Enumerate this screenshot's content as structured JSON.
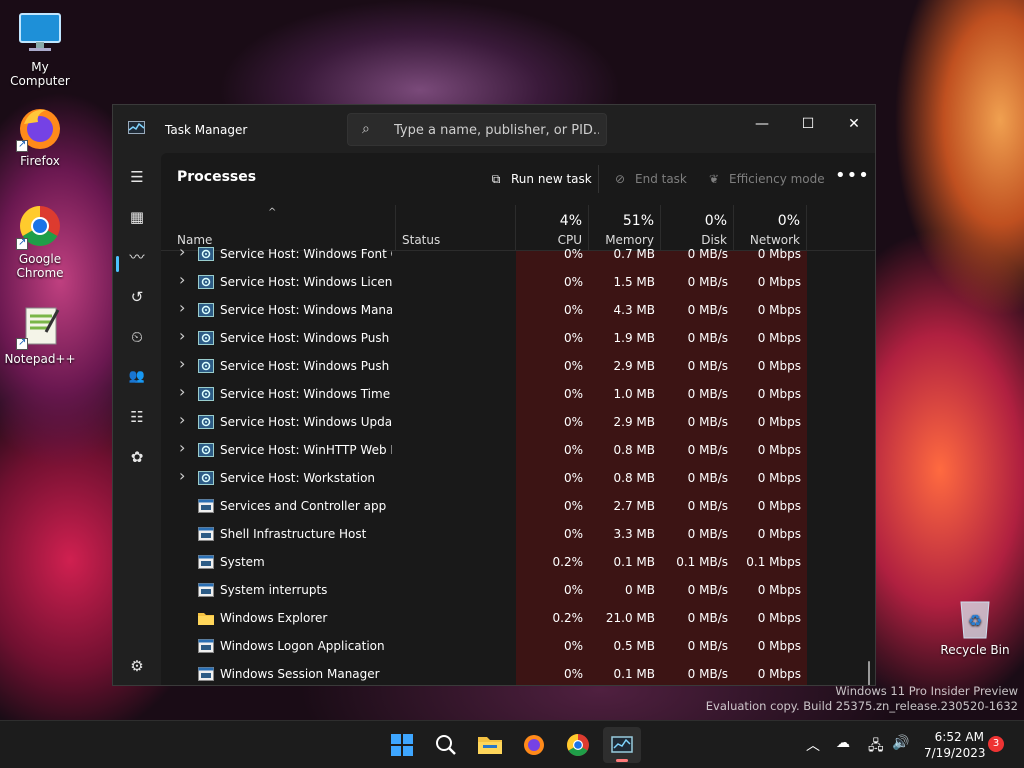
{
  "desktop": {
    "icons": [
      {
        "label": "My Computer"
      },
      {
        "label": "Firefox"
      },
      {
        "label": "Google Chrome"
      },
      {
        "label": "Notepad++"
      }
    ],
    "recycle_bin": "Recycle Bin",
    "watermark": {
      "line1": "Windows 11 Pro Insider Preview",
      "line2": "Evaluation copy. Build 25375.zn_release.230520-1632"
    }
  },
  "window": {
    "title": "Task Manager",
    "search_placeholder": "Type a name, publisher, or PID...",
    "controls": {
      "minimize": "—",
      "maximize": "☐",
      "close": "✕"
    }
  },
  "rail": {
    "items": [
      {
        "icon": "hamburger-icon",
        "glyph": "☰"
      },
      {
        "icon": "processes-icon",
        "glyph": "▦"
      },
      {
        "icon": "performance-icon",
        "glyph": "〰"
      },
      {
        "icon": "app-history-icon",
        "glyph": "↺"
      },
      {
        "icon": "startup-apps-icon",
        "glyph": "⏲"
      },
      {
        "icon": "users-icon",
        "glyph": "👥"
      },
      {
        "icon": "details-icon",
        "glyph": "☷"
      },
      {
        "icon": "services-icon",
        "glyph": "✿"
      },
      {
        "icon": "settings-icon",
        "glyph": "⚙"
      }
    ]
  },
  "page": {
    "heading": "Processes",
    "run_new_task": "Run new task",
    "end_task": "End task",
    "efficiency_mode": "Efficiency mode",
    "more": "•••"
  },
  "columns": {
    "name": "Name",
    "status": "Status",
    "cpu": {
      "label": "CPU",
      "pct": "4%"
    },
    "memory": {
      "label": "Memory",
      "pct": "51%"
    },
    "disk": {
      "label": "Disk",
      "pct": "0%"
    },
    "network": {
      "label": "Network",
      "pct": "0%"
    }
  },
  "processes": [
    {
      "name": "Service Host: Windows Font C...",
      "expandable": true,
      "icon": "gear",
      "cpu": "0%",
      "mem": "0.7 MB",
      "disk": "0 MB/s",
      "net": "0 Mbps"
    },
    {
      "name": "Service Host: Windows Licens...",
      "expandable": true,
      "icon": "gear",
      "cpu": "0%",
      "mem": "1.5 MB",
      "disk": "0 MB/s",
      "net": "0 Mbps"
    },
    {
      "name": "Service Host: Windows Manag...",
      "expandable": true,
      "icon": "gear",
      "cpu": "0%",
      "mem": "4.3 MB",
      "disk": "0 MB/s",
      "net": "0 Mbps"
    },
    {
      "name": "Service Host: Windows Push ...",
      "expandable": true,
      "icon": "gear",
      "cpu": "0%",
      "mem": "1.9 MB",
      "disk": "0 MB/s",
      "net": "0 Mbps"
    },
    {
      "name": "Service Host: Windows Push ...",
      "expandable": true,
      "icon": "gear",
      "cpu": "0%",
      "mem": "2.9 MB",
      "disk": "0 MB/s",
      "net": "0 Mbps"
    },
    {
      "name": "Service Host: Windows Time",
      "expandable": true,
      "icon": "gear",
      "cpu": "0%",
      "mem": "1.0 MB",
      "disk": "0 MB/s",
      "net": "0 Mbps"
    },
    {
      "name": "Service Host: Windows Update",
      "expandable": true,
      "icon": "gear",
      "cpu": "0%",
      "mem": "2.9 MB",
      "disk": "0 MB/s",
      "net": "0 Mbps"
    },
    {
      "name": "Service Host: WinHTTP Web P...",
      "expandable": true,
      "icon": "gear",
      "cpu": "0%",
      "mem": "0.8 MB",
      "disk": "0 MB/s",
      "net": "0 Mbps"
    },
    {
      "name": "Service Host: Workstation",
      "expandable": true,
      "icon": "gear",
      "cpu": "0%",
      "mem": "0.8 MB",
      "disk": "0 MB/s",
      "net": "0 Mbps"
    },
    {
      "name": "Services and Controller app",
      "expandable": false,
      "icon": "window",
      "cpu": "0%",
      "mem": "2.7 MB",
      "disk": "0 MB/s",
      "net": "0 Mbps"
    },
    {
      "name": "Shell Infrastructure Host",
      "expandable": false,
      "icon": "window",
      "cpu": "0%",
      "mem": "3.3 MB",
      "disk": "0 MB/s",
      "net": "0 Mbps"
    },
    {
      "name": "System",
      "expandable": false,
      "icon": "window",
      "cpu": "0.2%",
      "mem": "0.1 MB",
      "disk": "0.1 MB/s",
      "net": "0.1 Mbps"
    },
    {
      "name": "System interrupts",
      "expandable": false,
      "icon": "window",
      "cpu": "0%",
      "mem": "0 MB",
      "disk": "0 MB/s",
      "net": "0 Mbps"
    },
    {
      "name": "Windows Explorer",
      "expandable": false,
      "icon": "folder",
      "cpu": "0.2%",
      "mem": "21.0 MB",
      "disk": "0 MB/s",
      "net": "0 Mbps"
    },
    {
      "name": "Windows Logon Application",
      "expandable": false,
      "icon": "window",
      "cpu": "0%",
      "mem": "0.5 MB",
      "disk": "0 MB/s",
      "net": "0 Mbps"
    },
    {
      "name": "Windows Session Manager",
      "expandable": false,
      "icon": "window",
      "cpu": "0%",
      "mem": "0.1 MB",
      "disk": "0 MB/s",
      "net": "0 Mbps"
    }
  ],
  "taskbar": {
    "clock_time": "6:52 AM",
    "clock_date": "7/19/2023",
    "notifications": "3",
    "colors": {
      "accent": "#4cc2ff",
      "heat": "#3c1414"
    }
  }
}
